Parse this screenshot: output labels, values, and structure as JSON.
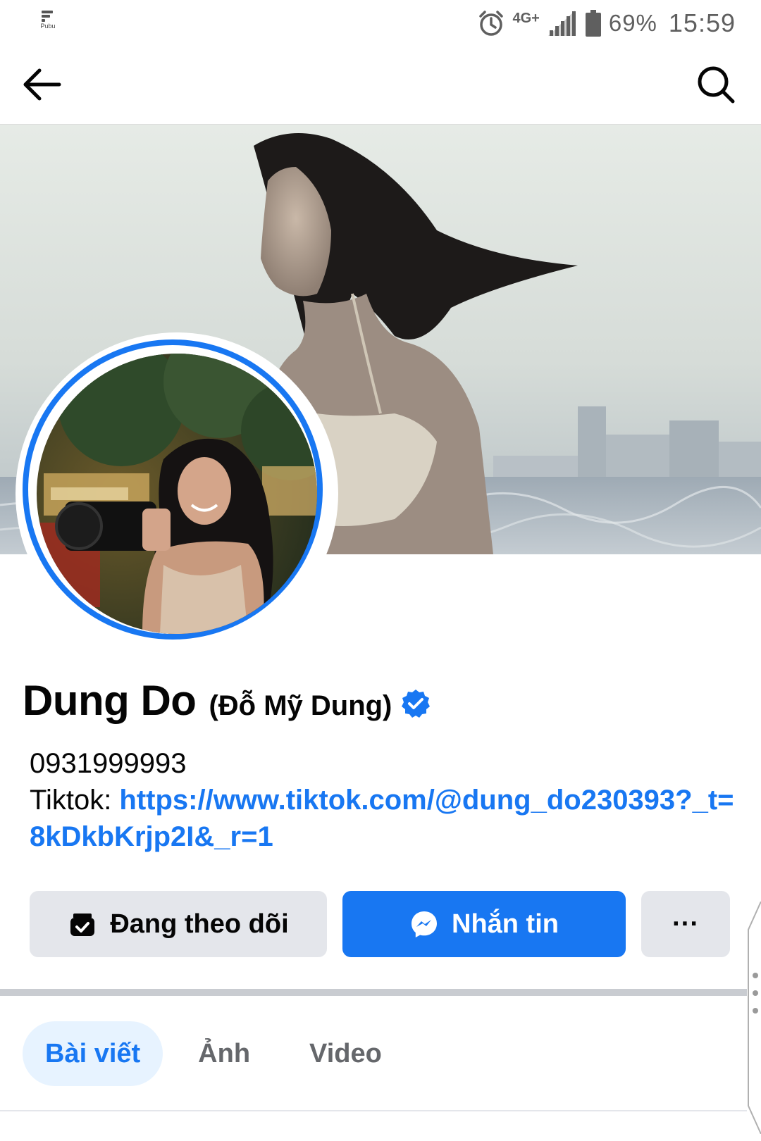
{
  "status_bar": {
    "app_logo_text": "Pubu",
    "network": "4G+",
    "battery": "69%",
    "time": "15:59"
  },
  "nav": {
    "back_icon": "back-arrow-icon",
    "search_icon": "search-icon"
  },
  "profile": {
    "name": "Dung Do",
    "alternate_name": "(Đỗ Mỹ Dung)",
    "verified": true,
    "bio_phone": "0931999993",
    "bio_tiktok_label": "Tiktok: ",
    "bio_tiktok_link": "https://www.tiktok.com/@dung_do230393?_t=8kDkbKrjp2I&_r=1"
  },
  "actions": {
    "following_label": "Đang theo dõi",
    "message_label": "Nhắn tin",
    "more_label": "···"
  },
  "tabs": [
    {
      "label": "Bài viết",
      "active": true
    },
    {
      "label": "Ảnh",
      "active": false
    },
    {
      "label": "Video",
      "active": false
    }
  ],
  "colors": {
    "accent": "#1877f2",
    "button_gray": "#e4e6eb",
    "tab_active_bg": "#e7f3ff",
    "text_primary": "#050505",
    "text_secondary": "#65676b"
  }
}
